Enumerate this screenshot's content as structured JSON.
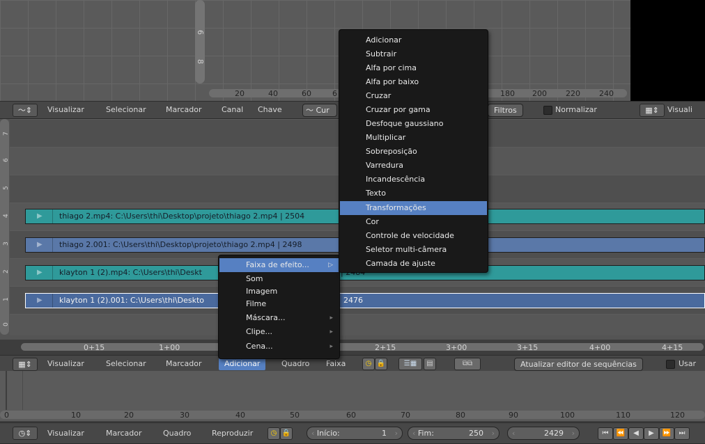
{
  "graph_editor": {
    "y_labels": [
      "6",
      "8"
    ],
    "x_labels": [
      "20",
      "40",
      "60",
      "6",
      "180",
      "200",
      "220",
      "240"
    ]
  },
  "graph_header": {
    "editor_icon": "graph-editor-icon",
    "menus": [
      "Visualizar",
      "Selecionar",
      "Marcador",
      "Canal",
      "Chave"
    ],
    "mode": "Cur",
    "filters": "Filtros",
    "normalize": "Normalizar",
    "right_menu": "Visuali"
  },
  "sequencer": {
    "channels": [
      "7",
      "6",
      "5",
      "4",
      "3",
      "2",
      "1",
      "0"
    ],
    "strips": [
      {
        "label": "thiago 2.mp4: C:\\Users\\thi\\Desktop\\projeto\\thiago 2.mp4 | 2504",
        "color": "#2f9a9a"
      },
      {
        "label": "thiago 2.001: C:\\Users\\thi\\Desktop\\projeto\\thiago 2.mp4 | 2498",
        "color": "#5a78a8"
      },
      {
        "label": "klayton 1 (2).mp4: C:\\Users\\thi\\Deskt",
        "tail": "| 2484",
        "color": "#2f9a9a"
      },
      {
        "label": "klayton 1 (2).001: C:\\Users\\thi\\Deskto",
        "tail": "2476",
        "color": "#4a6a9e"
      }
    ],
    "ruler": [
      "0+15",
      "1+00",
      "2+15",
      "3+00",
      "3+15",
      "4+00",
      "4+15"
    ]
  },
  "sequencer_header": {
    "menus": [
      "Visualizar",
      "Selecionar",
      "Marcador",
      "Adicionar",
      "Quadro",
      "Faixa"
    ],
    "active_menu": "Adicionar",
    "refresh_button": "Atualizar editor de sequências",
    "use": "Usar"
  },
  "timeline": {
    "ruler": [
      "0",
      "10",
      "20",
      "30",
      "40",
      "50",
      "60",
      "70",
      "80",
      "90",
      "100",
      "110",
      "120"
    ]
  },
  "timeline_header": {
    "menus": [
      "Visualizar",
      "Marcador",
      "Quadro",
      "Reproduzir"
    ],
    "start_label": "Início:",
    "start_value": "1",
    "end_label": "Fim:",
    "end_value": "250",
    "current_frame": "2429"
  },
  "add_menu": {
    "items": [
      "Faixa de efeito...",
      "Som",
      "Imagem",
      "Filme",
      "Máscara...",
      "Clipe...",
      "Cena..."
    ],
    "selected": 0,
    "has_sub": [
      true,
      false,
      false,
      false,
      true,
      true,
      true
    ]
  },
  "effect_menu": {
    "items": [
      "Adicionar",
      "Subtrair",
      "Alfa por cima",
      "Alfa por baixo",
      "Cruzar",
      "Cruzar por gama",
      "Desfoque gaussiano",
      "Multiplicar",
      "Sobreposição",
      "Varredura",
      "Incandescência",
      "Texto",
      "Transformações",
      "Cor",
      "Controle de velocidade",
      "Seletor multi-câmera",
      "Camada de ajuste"
    ],
    "selected": 12
  },
  "colors": {
    "menu_highlight": "#5680c2",
    "active_header_item": "#5680c2"
  }
}
